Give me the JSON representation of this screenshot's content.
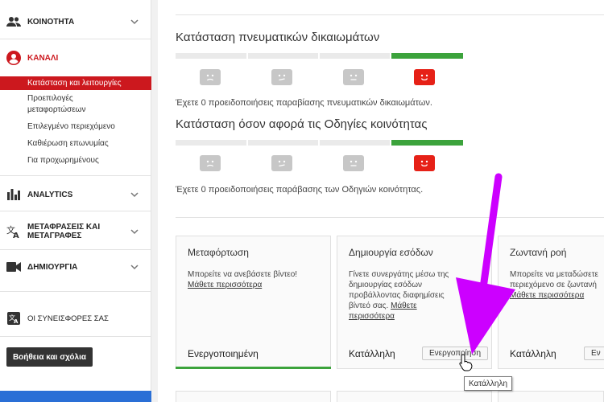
{
  "sidebar": {
    "community": "ΚΟΙΝΟΤΗΤΑ",
    "channel": "ΚΑΝΑΛΙ",
    "channel_items": [
      "Κατάσταση και λειτουργίες",
      "Προεπιλογές",
      "μεταφορτώσεων",
      "Επιλεγμένο περιεχόμενο",
      "Καθιέρωση επωνυμίας",
      "Για προχωρημένους"
    ],
    "analytics": "ANALYTICS",
    "translations_line1": "ΜΕΤΑΦΡΑΣΕΙΣ ΚΑΙ",
    "translations_line2": "ΜΕΤΑΓΡΑΦΕΣ",
    "create": "ΔΗΜΙΟΥΡΓΙΑ",
    "contributions": "ΟΙ ΣΥΝΕΙΣΦΟΡΕΣ ΣΑΣ",
    "feedback": "Βοήθεια και σχόλια"
  },
  "copyright": {
    "title": "Κατάσταση πνευματικών δικαιωμάτων",
    "note": "Έχετε 0 προειδοποιήσεις παραβίασης πνευματικών δικαιωμάτων."
  },
  "community": {
    "title": "Κατάσταση όσον αφορά τις Οδηγίες κοινότητας",
    "note": "Έχετε 0 προειδοποιήσεις παράβασης των Οδηγιών κοινότητας."
  },
  "cards": [
    {
      "title": "Μεταφόρτωση",
      "desc": "Μπορείτε να ανεβάσετε βίντεο!",
      "link": "Μάθετε περισσότερα",
      "status": "Ενεργοποιημένη"
    },
    {
      "title": "Δημιουργία εσόδων",
      "desc_lines": [
        "Γίνετε συνεργάτης μέσω της",
        "δημιουργίας εσόδων",
        "προβάλλοντας διαφημίσεις",
        "βίντεό σας."
      ],
      "link1": "Μάθετε",
      "link2": "περισσότερα",
      "status": "Κατάλληλη",
      "button": "Ενεργοποίηση"
    },
    {
      "title": "Ζωντανή ροή",
      "desc_lines": [
        "Μπορείτε να μεταδώσετε",
        "περιεχόμενο σε ζωντανή"
      ],
      "link": "Μάθετε περισσότερα",
      "status": "Κατάλληλη",
      "button": "Εν"
    }
  ],
  "tooltip": "Κατάλληλη",
  "colors": {
    "accent_red": "#cc181e",
    "good_green": "#3ca33c",
    "annotation_arrow": "#cc00ff"
  }
}
